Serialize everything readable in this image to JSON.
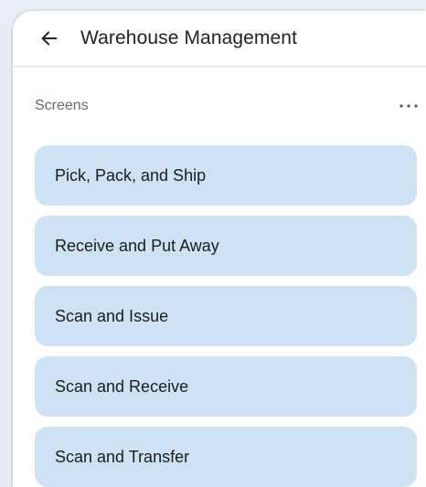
{
  "header": {
    "title": "Warehouse Management",
    "back_icon": "arrow-left-icon"
  },
  "section": {
    "label": "Screens",
    "more_icon": "more-horizontal-icon"
  },
  "screens": [
    {
      "label": "Pick, Pack, and Ship"
    },
    {
      "label": "Receive and Put Away"
    },
    {
      "label": "Scan and Issue"
    },
    {
      "label": "Scan and Receive"
    },
    {
      "label": "Scan and Transfer"
    }
  ],
  "colors": {
    "item_background": "#cde3f5",
    "page_background": "#e8eef6",
    "text_primary": "#222222",
    "text_secondary": "#6a6a6a"
  }
}
